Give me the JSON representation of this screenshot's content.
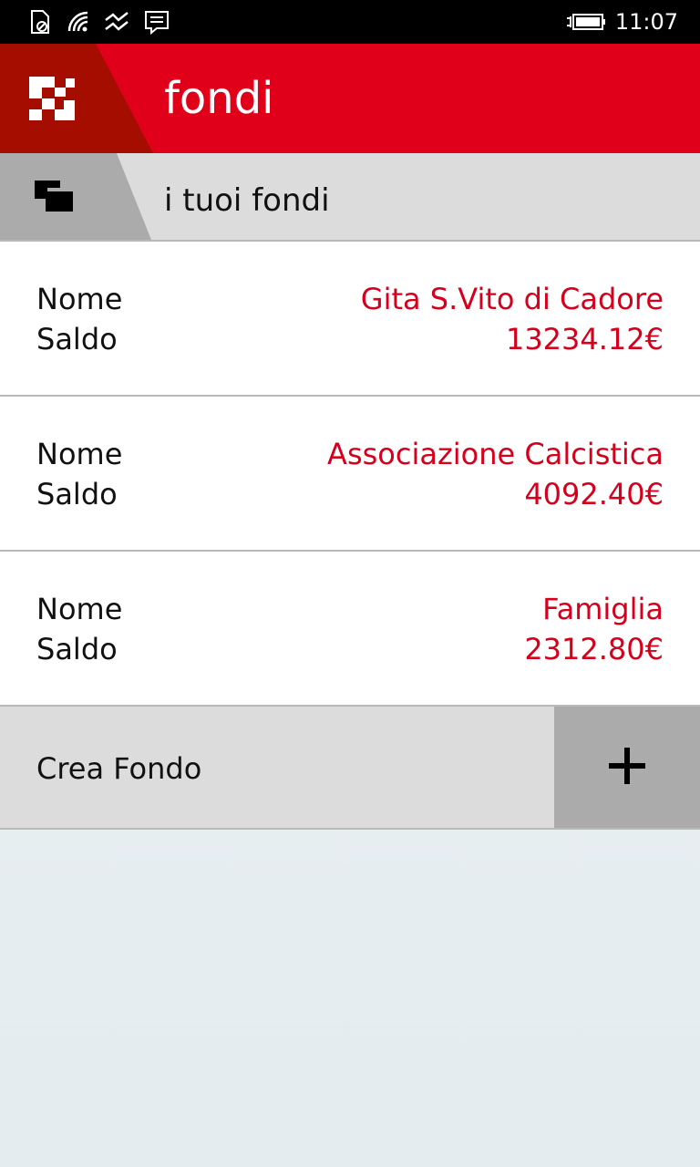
{
  "status_bar": {
    "time": "11:07",
    "icons": [
      "sim-off-icon",
      "wifi-icon",
      "signal-icon",
      "message-icon",
      "battery-icon"
    ]
  },
  "header": {
    "title": "fondi",
    "logo": "unicredit-logo-icon",
    "color": "#e1001a"
  },
  "subheader": {
    "title": "i tuoi fondi",
    "icon": "funds-stack-icon"
  },
  "funds": [
    {
      "nome_label": "Nome",
      "saldo_label": "Saldo",
      "nome": "Gita S.Vito di Cadore",
      "saldo": "13234.12€"
    },
    {
      "nome_label": "Nome",
      "saldo_label": "Saldo",
      "nome": "Associazione Calcistica",
      "saldo": "4092.40€"
    },
    {
      "nome_label": "Nome",
      "saldo_label": "Saldo",
      "nome": "Famiglia",
      "saldo": "2312.80€"
    }
  ],
  "create": {
    "label": "Crea Fondo",
    "icon": "plus-icon"
  },
  "colors": {
    "accent": "#d4001c",
    "header_red": "#e1001a",
    "logo_dark_red": "#a50d00",
    "row_gray": "#dcdcdc",
    "button_gray": "#ababab"
  }
}
